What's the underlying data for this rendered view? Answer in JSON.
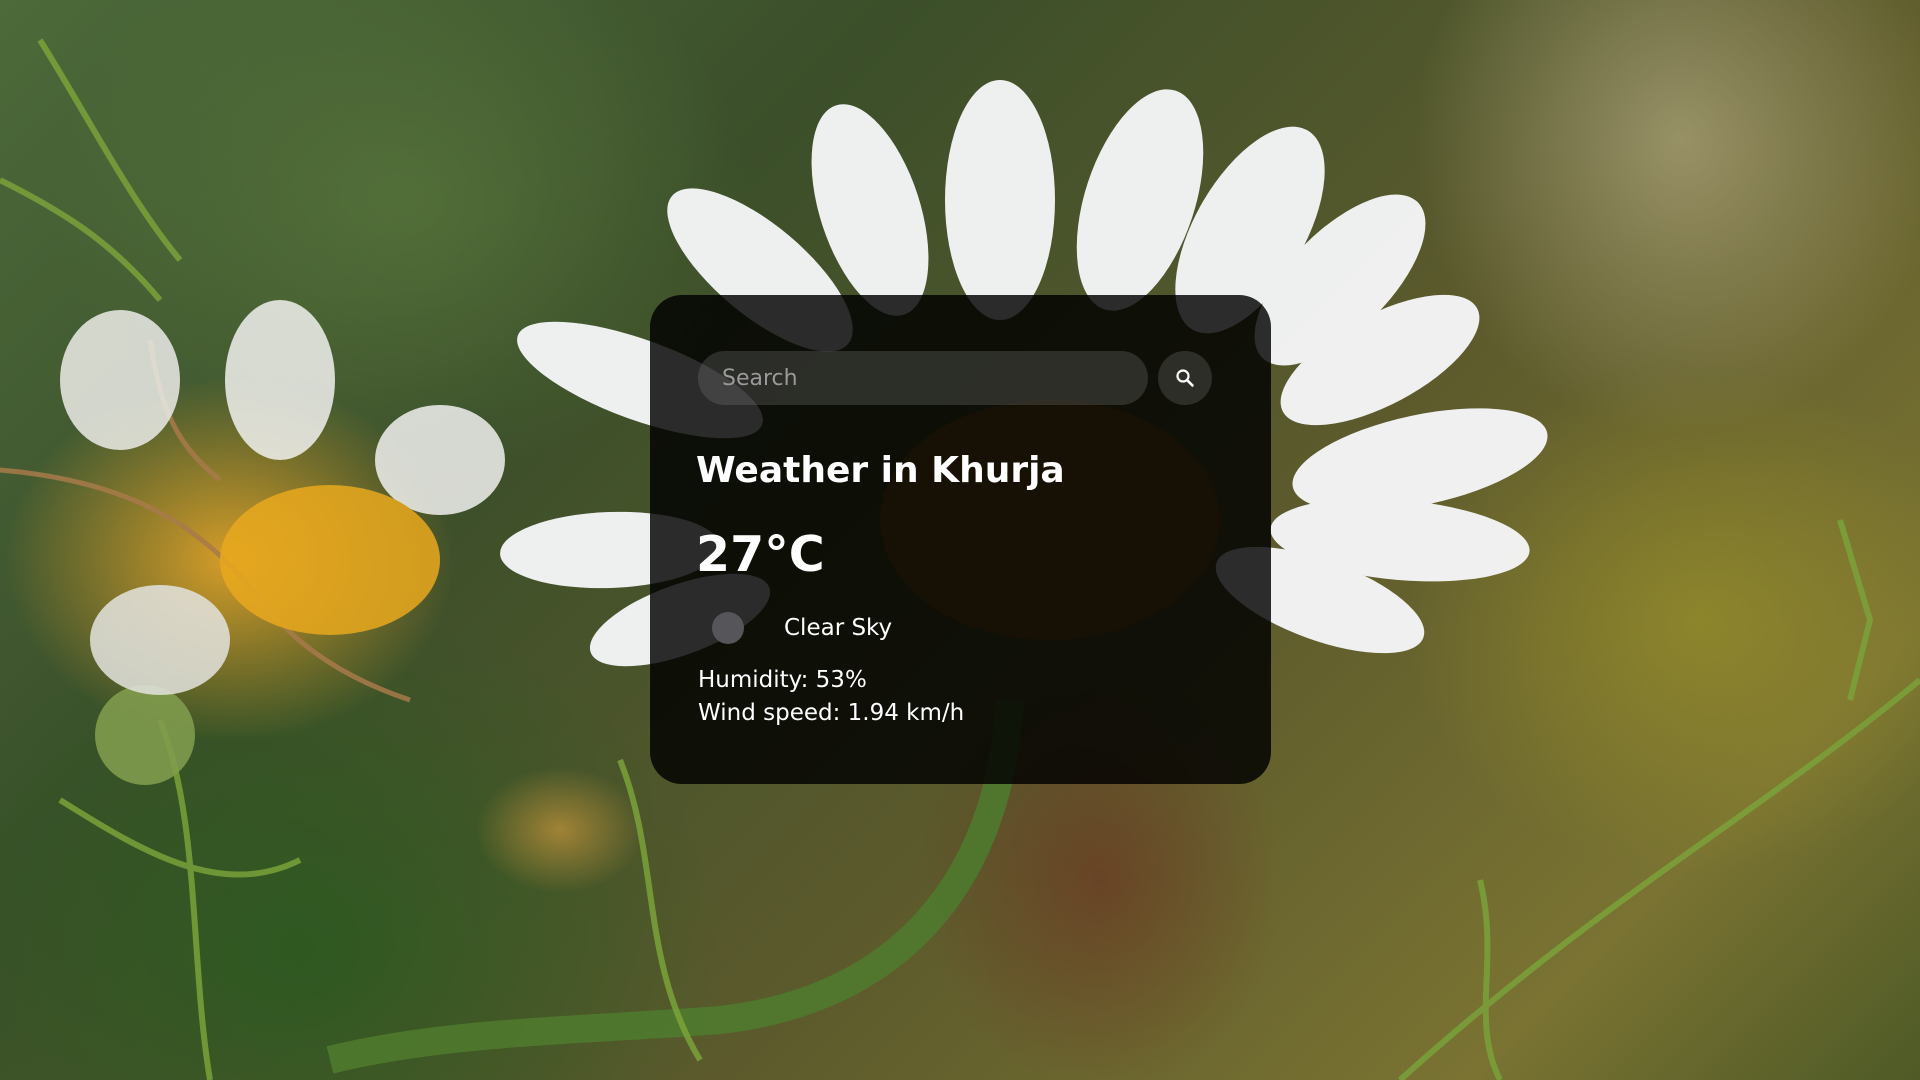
{
  "search": {
    "placeholder": "Search",
    "value": ""
  },
  "weather": {
    "title": "Weather in Khurja",
    "temperature": "27°C",
    "description": "Clear Sky",
    "humidity": "Humidity: 53%",
    "wind": "Wind speed: 1.94 km/h",
    "icon": "clear-sky-icon"
  },
  "icons": {
    "search_button": "search-icon"
  },
  "colors": {
    "card_background": "#000000",
    "text": "#ffffff",
    "input_background": "#7c7c7c"
  }
}
